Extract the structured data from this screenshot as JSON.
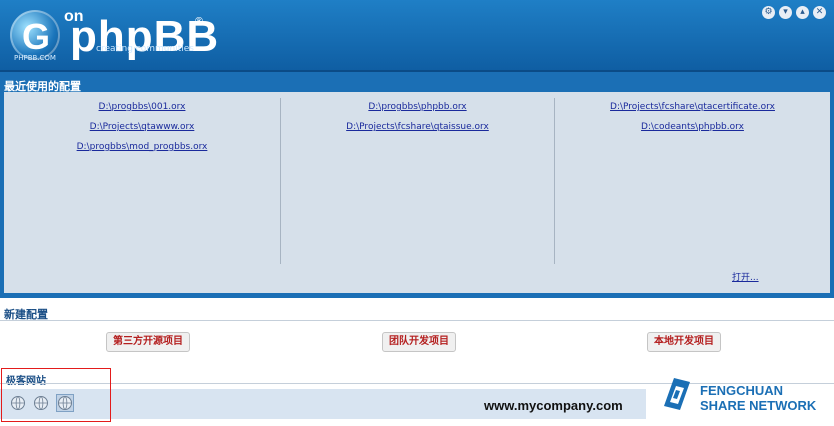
{
  "header": {
    "logo_on": "on",
    "logo_brand": "phpBB",
    "logo_reg": "®",
    "logo_tag": "creating communities",
    "logo_sub": "PHPBB.COM",
    "controls": [
      "gear-icon",
      "minimize-icon",
      "maximize-icon",
      "close-icon"
    ]
  },
  "recent": {
    "title": "最近使用的配置",
    "columns": [
      [
        "D:\\progbbs\\001.orx",
        "D:\\Projects\\qtawww.orx",
        "D:\\progbbs\\mod_progbbs.orx"
      ],
      [
        "D:\\progbbs\\phpbb.orx",
        "D:\\Projects\\fcshare\\qtaissue.orx"
      ],
      [
        "D:\\Projects\\fcshare\\qtacertificate.orx",
        "D:\\codeants\\phpbb.orx"
      ]
    ],
    "open_label": "打开..."
  },
  "new_config": {
    "title": "新建配置",
    "buttons": [
      "第三方开源项目",
      "团队开发项目",
      "本地开发项目"
    ]
  },
  "blog": {
    "title": "极客网站",
    "icons": [
      "globe-icon",
      "globe-icon",
      "globe-icon"
    ],
    "url": "www.mycompany.com"
  },
  "company": {
    "name_line1": "FENGCHUAN",
    "name_line2": "SHARE NETWORK"
  },
  "colors": {
    "header_blue": "#1b6fb5",
    "panel_bg": "#d6e0ea",
    "link": "#1a2a9c",
    "button_text": "#b41e1e",
    "highlight_box": "#e31b1b"
  }
}
